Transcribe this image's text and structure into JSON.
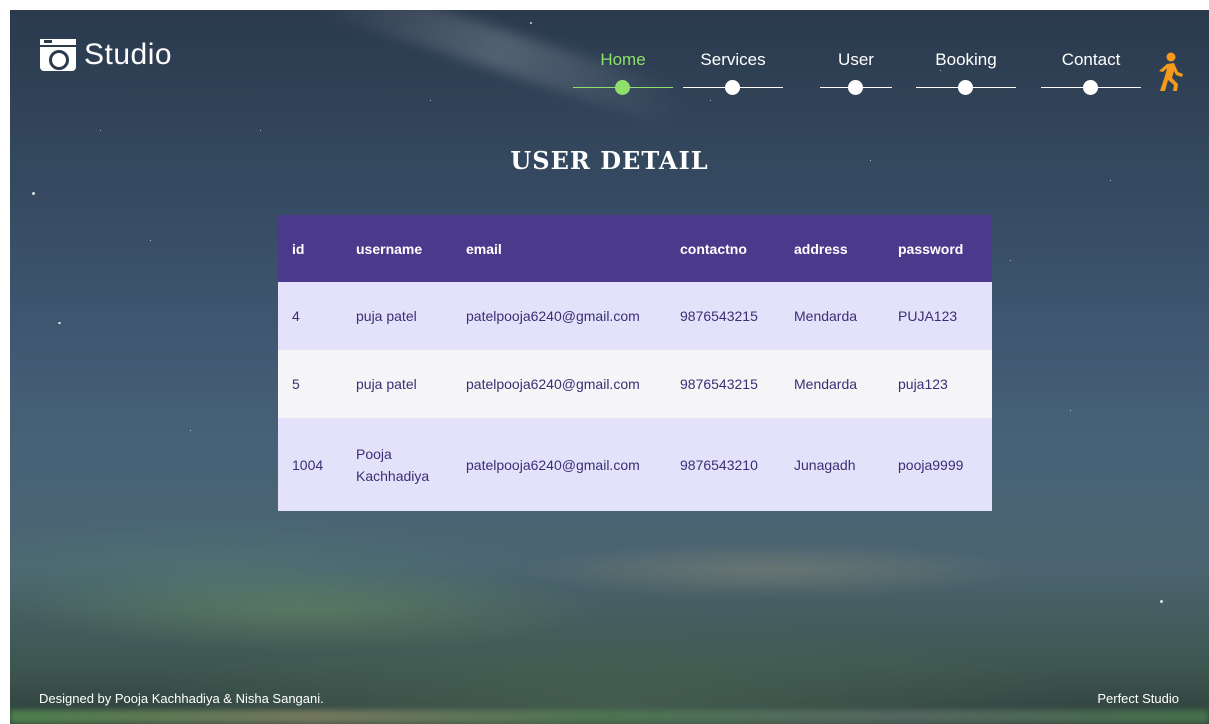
{
  "brand": {
    "name": "Studio"
  },
  "nav": {
    "items": [
      {
        "label": "Home",
        "active": true
      },
      {
        "label": "Services",
        "active": false
      },
      {
        "label": "User",
        "active": false
      },
      {
        "label": "Booking",
        "active": false
      },
      {
        "label": "Contact",
        "active": false
      }
    ],
    "active_color": "#8ee06a",
    "walker_icon_color": "#f59a1a"
  },
  "page": {
    "title": "USER DETAIL"
  },
  "table": {
    "columns": [
      "id",
      "username",
      "email",
      "contactno",
      "address",
      "password"
    ],
    "rows": [
      {
        "id": "4",
        "username": "puja patel",
        "email": "patelpooja6240@gmail.com",
        "contactno": "9876543215",
        "address": "Mendarda",
        "password": "PUJA123"
      },
      {
        "id": "5",
        "username": "puja patel",
        "email": "patelpooja6240@gmail.com",
        "contactno": "9876543215",
        "address": "Mendarda",
        "password": "puja123"
      },
      {
        "id": "1004",
        "username": "Pooja Kachhadiya",
        "email": "patelpooja6240@gmail.com",
        "contactno": "9876543210",
        "address": "Junagadh",
        "password": "pooja9999"
      }
    ],
    "header_color": "#4b3a8c"
  },
  "footer": {
    "credit": "Designed by Pooja Kachhadiya & Nisha Sangani.",
    "brand": "Perfect Studio"
  }
}
